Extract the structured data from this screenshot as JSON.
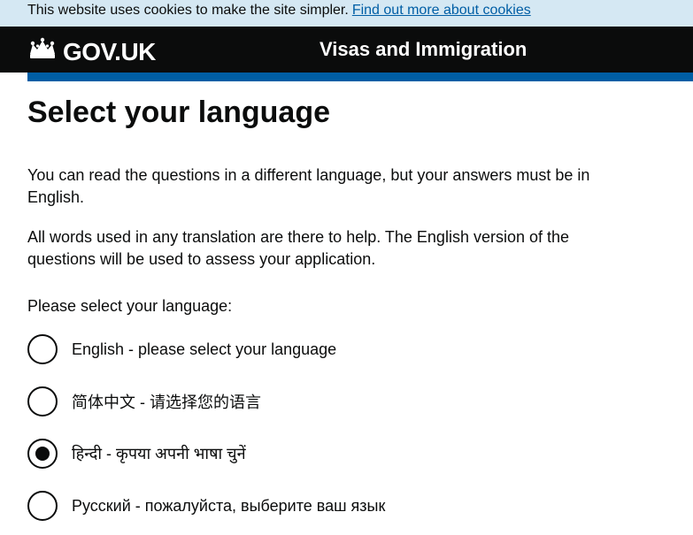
{
  "cookie_banner": {
    "text": "This website uses cookies to make the site simpler.",
    "link": "Find out more about cookies"
  },
  "header": {
    "logo_text": "GOV.UK",
    "logo_icon": "crown-icon",
    "service_name": "Visas and Immigration"
  },
  "page": {
    "title": "Select your language",
    "intro": "You can read the questions in a different language, but your answers must be in English.",
    "note": "All words used in any translation are there to help. The English version of the questions will be used to assess your application.",
    "question": "Please select your language:"
  },
  "options": [
    {
      "label": "English - please select your language",
      "checked": false
    },
    {
      "label": "简体中文 - 请选择您的语言",
      "checked": false
    },
    {
      "label": "हिन्दी - कृपया अपनी भाषा चुनें",
      "checked": true
    },
    {
      "label": "Русский - пожалуйста, выберите ваш язык",
      "checked": false
    }
  ],
  "colors": {
    "header_bg": "#0b0c0c",
    "accent_stripe": "#005ea5",
    "cookie_bg": "#d5e8f3",
    "link": "#005ea5"
  }
}
